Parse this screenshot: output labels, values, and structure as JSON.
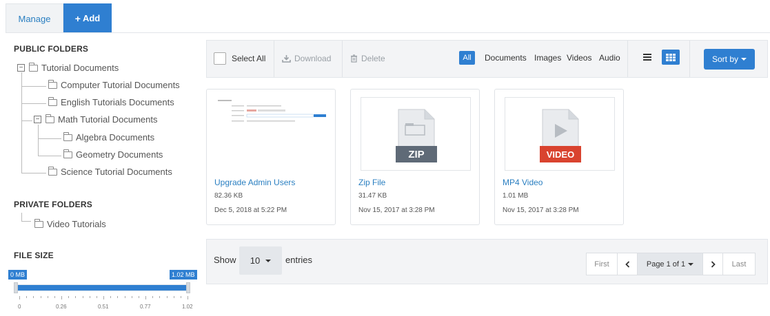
{
  "tabs": {
    "manage": "Manage",
    "add": "Add"
  },
  "sidebar": {
    "public_heading": "PUBLIC FOLDERS",
    "public_tree": {
      "root": "Tutorial Documents",
      "computer": "Computer Tutorial Documents",
      "english": "English Tutorials Documents",
      "math": "Math Tutorial Documents",
      "algebra": "Algebra Documents",
      "geometry": "Geometry Documents",
      "science": "Science Tutorial Documents"
    },
    "private_heading": "PRIVATE FOLDERS",
    "private_tree": {
      "video": "Video Tutorials"
    },
    "filesize_heading": "FILE SIZE",
    "slider": {
      "min_label": "0 MB",
      "max_label": "1.02 MB",
      "min_value": 0,
      "max_value": 1.02,
      "ticks": [
        "0",
        "0.26",
        "0.51",
        "0.77",
        "1.02"
      ]
    }
  },
  "toolbar": {
    "select_all": "Select All",
    "download": "Download",
    "delete": "Delete",
    "filters": {
      "all": "All",
      "documents": "Documents",
      "images": "Images",
      "videos": "Videos",
      "audio": "Audio"
    },
    "sort_by": "Sort by"
  },
  "files": [
    {
      "title": "Upgrade Admin Users",
      "size": "82.36 KB",
      "date": "Dec 5, 2018 at 5:22 PM"
    },
    {
      "title": "Zip File",
      "size": "31.47 KB",
      "date": "Nov 15, 2017 at 3:28 PM",
      "badge": "ZIP"
    },
    {
      "title": "MP4 Video",
      "size": "1.01 MB",
      "date": "Nov 15, 2017 at 3:28 PM",
      "badge": "VIDEO"
    }
  ],
  "pager": {
    "show": "Show",
    "entries_value": "10",
    "entries": "entries",
    "first": "First",
    "page_label": "Page 1 of 1",
    "last": "Last"
  },
  "colors": {
    "accent": "#2f7fd1",
    "zip_badge": "#5f6a77",
    "video_badge": "#d9432f"
  }
}
